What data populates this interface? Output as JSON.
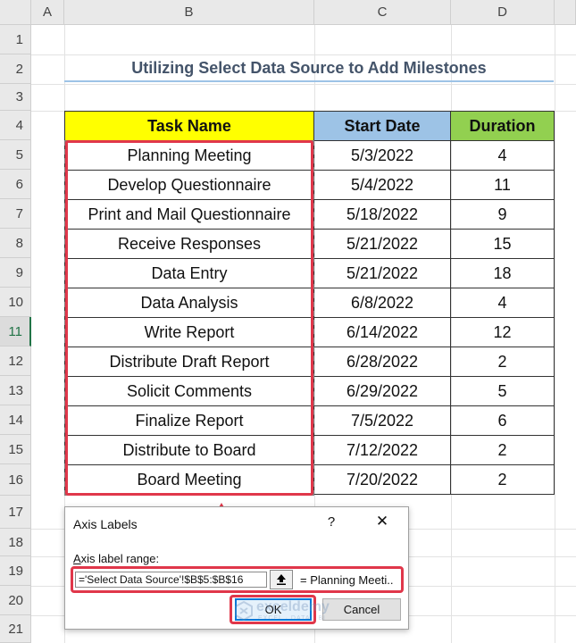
{
  "columns": [
    "A",
    "B",
    "C",
    "D"
  ],
  "rows": [
    "1",
    "2",
    "3",
    "4",
    "5",
    "6",
    "7",
    "8",
    "9",
    "10",
    "11",
    "12",
    "13",
    "14",
    "15",
    "16",
    "17",
    "18",
    "19",
    "20",
    "21"
  ],
  "title": "Utilizing Select Data Source to Add Milestones",
  "table": {
    "headers": [
      "Task Name",
      "Start Date",
      "Duration"
    ],
    "rows": [
      [
        "Planning Meeting",
        "5/3/2022",
        "4"
      ],
      [
        "Develop Questionnaire",
        "5/4/2022",
        "11"
      ],
      [
        "Print and Mail Questionnaire",
        "5/18/2022",
        "9"
      ],
      [
        "Receive Responses",
        "5/21/2022",
        "15"
      ],
      [
        "Data Entry",
        "5/21/2022",
        "18"
      ],
      [
        "Data Analysis",
        "6/8/2022",
        "4"
      ],
      [
        "Write Report",
        "6/14/2022",
        "12"
      ],
      [
        "Distribute Draft Report",
        "6/28/2022",
        "2"
      ],
      [
        "Solicit Comments",
        "6/29/2022",
        "5"
      ],
      [
        "Finalize Report",
        "7/5/2022",
        "6"
      ],
      [
        "Distribute to Board",
        "7/12/2022",
        "2"
      ],
      [
        "Board Meeting",
        "7/20/2022",
        "2"
      ]
    ]
  },
  "dialog": {
    "title": "Axis Labels",
    "help": "?",
    "close": "✕",
    "label_accel": "A",
    "label_rest": "xis label range:",
    "range_value": "='Select Data Source'!$B$5:$B$16",
    "collapse_icon": "collapse-dialog-icon",
    "preview": "= Planning Meeti..",
    "ok": "OK",
    "cancel": "Cancel"
  },
  "watermark": {
    "name": "exceldemy",
    "sub": "EXCEL · DATA · BI"
  },
  "colors": {
    "task_header": "#ffff00",
    "start_header": "#9dc3e6",
    "duration_header": "#92d050",
    "highlight": "#e0374a"
  }
}
